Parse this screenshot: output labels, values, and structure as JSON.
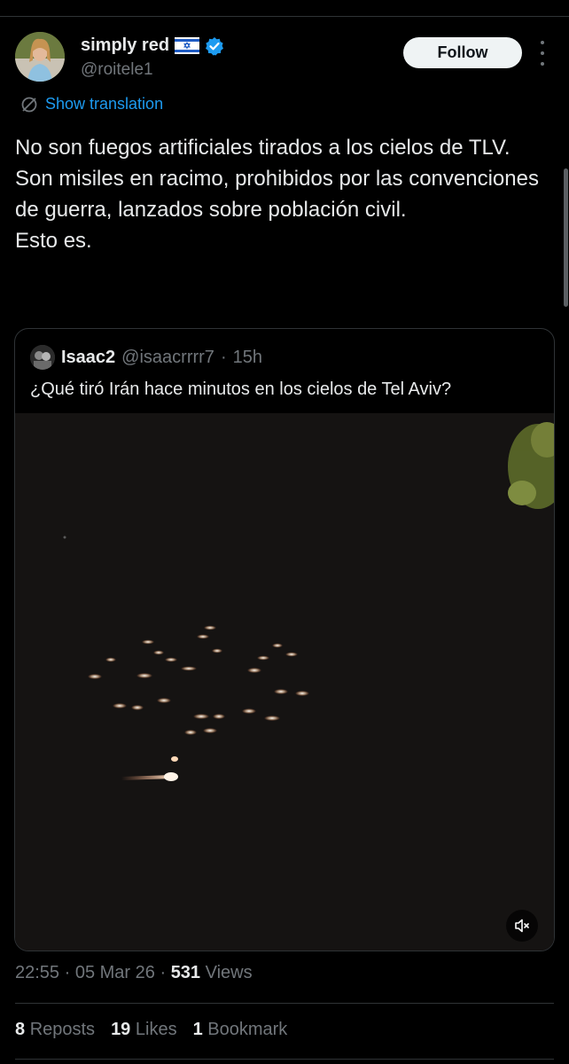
{
  "author": {
    "name": "simply red",
    "handle": "@roitele1",
    "follow_label": "Follow"
  },
  "translate_label": "Show translation",
  "post_text": "No son fuegos artificiales tirados a los cielos de TLV.\nSon misiles en racimo, prohibidos por las convenciones de guerra, lanzados sobre población civil.\nEsto es.",
  "quoted": {
    "name": "Isaac2",
    "handle": "@isaacrrrr7",
    "time": "15h",
    "text": "¿Qué tiró Irán hace minutos en los cielos de Tel Aviv?"
  },
  "meta": {
    "time": "22:55",
    "date": "05 Mar 26",
    "views_count": "531",
    "views_label": "Views"
  },
  "stats": {
    "reposts_count": "8",
    "reposts_label": "Reposts",
    "likes_count": "19",
    "likes_label": "Likes",
    "bookmarks_count": "1",
    "bookmarks_label": "Bookmark"
  },
  "colors": {
    "accent": "#1d9bf0",
    "secondary_text": "#71767b",
    "primary_text": "#e7e9ea"
  }
}
